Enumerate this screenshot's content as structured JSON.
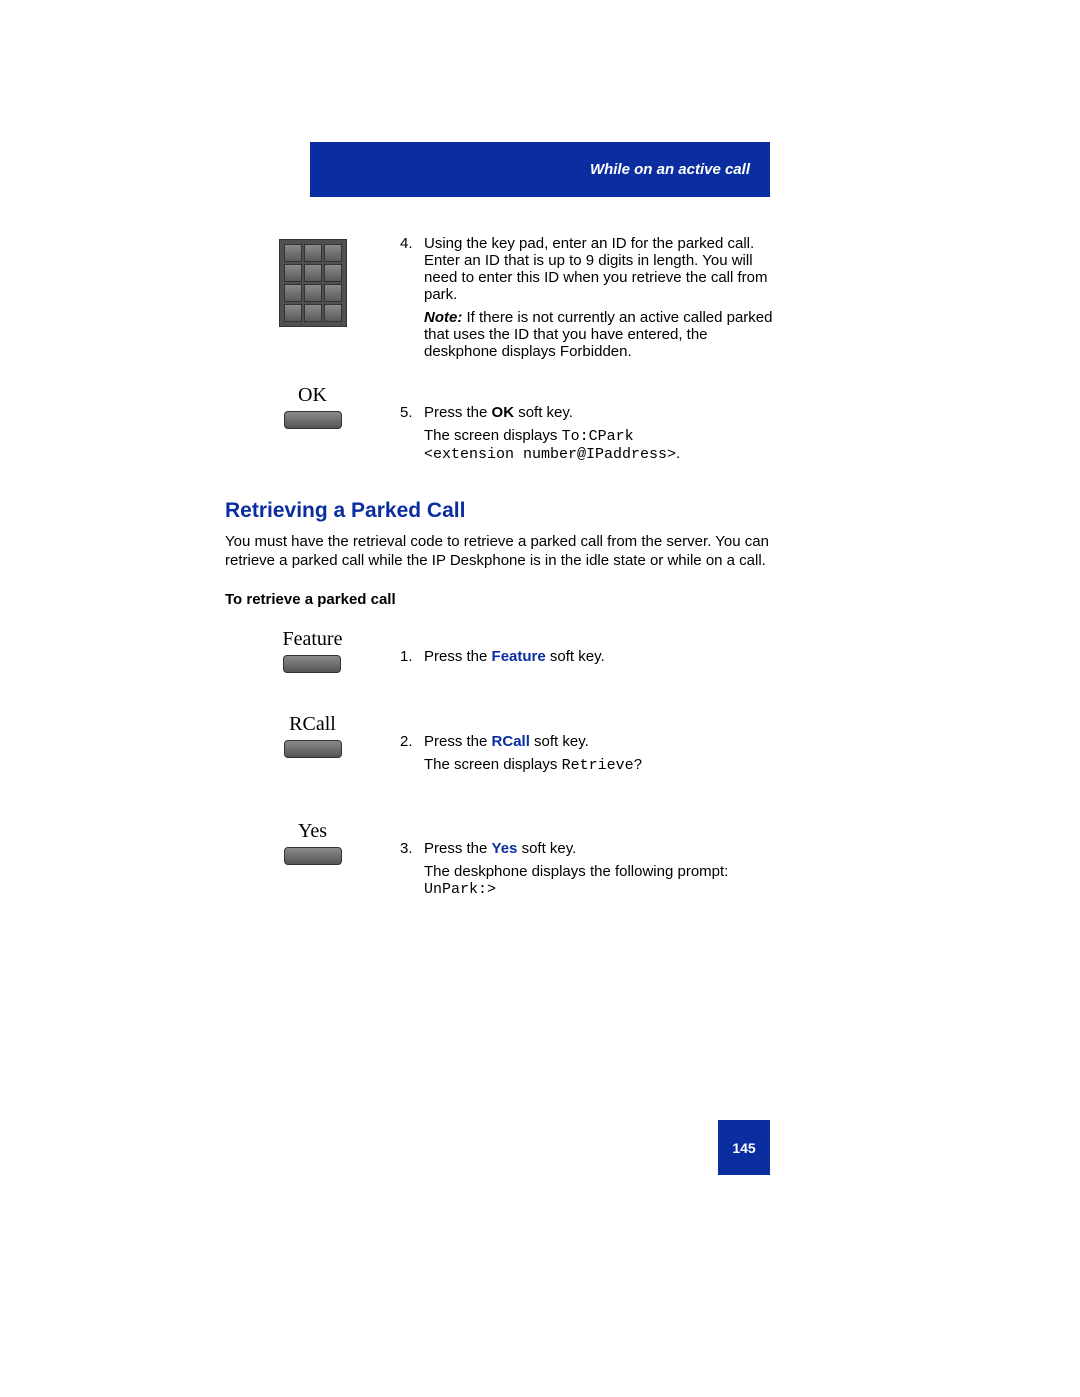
{
  "header": {
    "title": "While on an active call"
  },
  "steps_top": {
    "keypad": {
      "num": "4.",
      "text": "Using the key pad, enter an ID for the parked call. Enter an ID that is up to 9 digits in length. You will need to enter this ID when you retrieve the call from park.",
      "note_label": "Note:",
      "note_text": " If there is not currently an active called parked that uses the ID that you have entered, the deskphone displays Forbidden."
    },
    "ok": {
      "label": "OK",
      "num": "5.",
      "text_prefix": "Press the ",
      "bold": "OK",
      "text_suffix": " soft key.",
      "line2_prefix": "The screen displays ",
      "mono1": "To:CPark",
      "mono2": "<extension number@IPaddress>",
      "period": "."
    }
  },
  "section": {
    "heading": "Retrieving a Parked Call",
    "intro": "You must have the retrieval code to retrieve a parked call from the server. You can retrieve a parked call while the IP Deskphone is in the idle state or while on a call.",
    "subhead": "To retrieve a parked call"
  },
  "steps_bottom": {
    "feature": {
      "label": "Feature",
      "num": "1.",
      "text_prefix": "Press the ",
      "bold": "Feature",
      "text_suffix": " soft key."
    },
    "rcall": {
      "label": "RCall",
      "num": "2.",
      "text_prefix": "Press the ",
      "bold": "RCall",
      "text_suffix": " soft key.",
      "line2_prefix": "The screen displays ",
      "mono": "Retrieve?"
    },
    "yes": {
      "label": "Yes",
      "num": "3.",
      "text_prefix": "Press the ",
      "bold": "Yes",
      "text_suffix": " soft key.",
      "line2_prefix": "The deskphone displays the following prompt: ",
      "mono": "UnPark:>"
    }
  },
  "page_number": "145"
}
